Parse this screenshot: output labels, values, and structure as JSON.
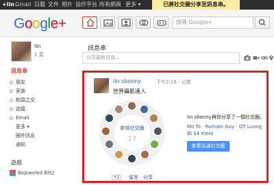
{
  "topbar": {
    "items": [
      "+lin",
      "Gmail",
      "日曆",
      "文件",
      "相片",
      "協作平台",
      "所有網頁",
      "更多 ▾"
    ],
    "notification": "已將社交圈分享至訊息串。"
  },
  "header": {
    "logo": "Google+",
    "search_placeholder": "搜尋 Google+"
  },
  "user": {
    "name": "lin",
    "circle_count": "1 頁"
  },
  "sidebar": {
    "heading": "訊息串",
    "items": [
      "朋友",
      "家族",
      "點頭之交",
      "追蹤",
      "Email",
      "更多 ▾",
      "圈外訊息",
      "通知"
    ]
  },
  "games": {
    "heading": "遊戲",
    "item": "Bejeweled Blitz"
  },
  "stream": {
    "title": "訊息串",
    "share_placeholder": "分享最新訊息..."
  },
  "post": {
    "author": "lin sbonny",
    "time": "下午2:16",
    "visibility": "公開",
    "text": "世界攝影達人",
    "circle_label": "新增社交圈",
    "circle_count": "17",
    "share_desc": "lin sbonny與你分享了一個社交圈。",
    "shared_with": [
      "Mo To",
      "Romain Guy",
      "QT Luong"
    ],
    "shared_more": "和 14 more",
    "view_button": "查看及通社交圈",
    "actions": {
      "plus": "+1",
      "comment": "留言",
      "share": "分享"
    }
  },
  "colors": {
    "accent_red": "#d14836",
    "link_blue": "#2a5db0",
    "button_blue": "#4d90fe",
    "highlight_border": "#e02020"
  }
}
